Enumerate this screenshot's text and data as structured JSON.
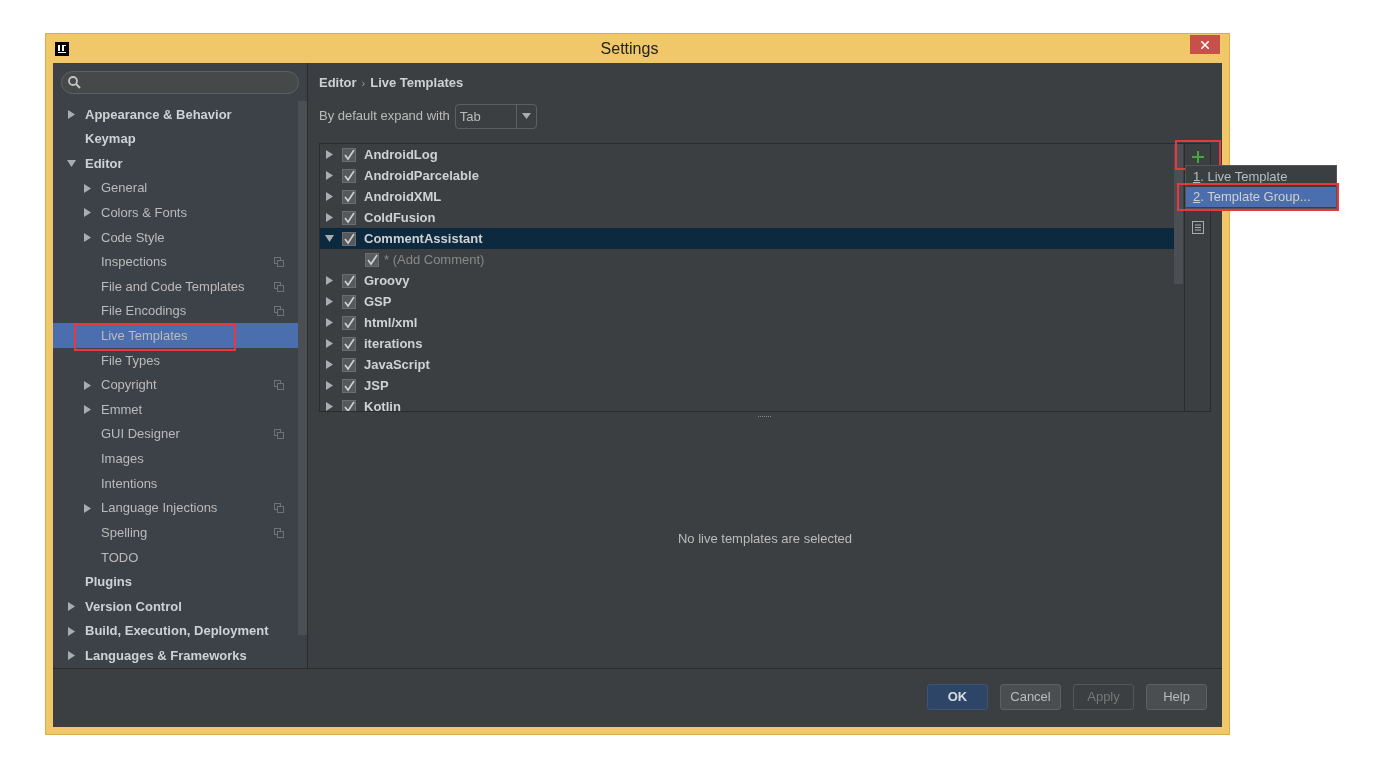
{
  "window": {
    "title": "Settings"
  },
  "sidebar": {
    "items": [
      {
        "label": "Appearance & Behavior",
        "expandable": true,
        "expanded": false,
        "selected": false,
        "highlighted": false,
        "project_level": false
      },
      {
        "label": "Keymap",
        "expandable": false,
        "expanded": false,
        "selected": false,
        "highlighted": false,
        "project_level": false
      },
      {
        "label": "Editor",
        "expandable": true,
        "expanded": true,
        "selected": false,
        "highlighted": false,
        "project_level": false,
        "children": [
          {
            "label": "General",
            "expandable": true,
            "expanded": false,
            "selected": false,
            "highlighted": false,
            "project_level": false
          },
          {
            "label": "Colors & Fonts",
            "expandable": true,
            "expanded": false,
            "selected": false,
            "highlighted": false,
            "project_level": false
          },
          {
            "label": "Code Style",
            "expandable": true,
            "expanded": false,
            "selected": false,
            "highlighted": false,
            "project_level": false
          },
          {
            "label": "Inspections",
            "expandable": false,
            "expanded": false,
            "selected": false,
            "highlighted": false,
            "project_level": true
          },
          {
            "label": "File and Code Templates",
            "expandable": false,
            "expanded": false,
            "selected": false,
            "highlighted": false,
            "project_level": true
          },
          {
            "label": "File Encodings",
            "expandable": false,
            "expanded": false,
            "selected": false,
            "highlighted": false,
            "project_level": true
          },
          {
            "label": "Live Templates",
            "expandable": false,
            "expanded": false,
            "selected": true,
            "highlighted": true,
            "project_level": false
          },
          {
            "label": "File Types",
            "expandable": false,
            "expanded": false,
            "selected": false,
            "highlighted": false,
            "project_level": false
          },
          {
            "label": "Copyright",
            "expandable": true,
            "expanded": false,
            "selected": false,
            "highlighted": false,
            "project_level": true
          },
          {
            "label": "Emmet",
            "expandable": true,
            "expanded": false,
            "selected": false,
            "highlighted": false,
            "project_level": false
          },
          {
            "label": "GUI Designer",
            "expandable": false,
            "expanded": false,
            "selected": false,
            "highlighted": false,
            "project_level": true
          },
          {
            "label": "Images",
            "expandable": false,
            "expanded": false,
            "selected": false,
            "highlighted": false,
            "project_level": false
          },
          {
            "label": "Intentions",
            "expandable": false,
            "expanded": false,
            "selected": false,
            "highlighted": false,
            "project_level": false
          },
          {
            "label": "Language Injections",
            "expandable": true,
            "expanded": false,
            "selected": false,
            "highlighted": false,
            "project_level": true
          },
          {
            "label": "Spelling",
            "expandable": false,
            "expanded": false,
            "selected": false,
            "highlighted": false,
            "project_level": true
          },
          {
            "label": "TODO",
            "expandable": false,
            "expanded": false,
            "selected": false,
            "highlighted": false,
            "project_level": false
          }
        ]
      },
      {
        "label": "Plugins",
        "expandable": false,
        "expanded": false,
        "selected": false,
        "highlighted": false,
        "project_level": false
      },
      {
        "label": "Version Control",
        "expandable": true,
        "expanded": false,
        "selected": false,
        "highlighted": false,
        "project_level": false
      },
      {
        "label": "Build, Execution, Deployment",
        "expandable": true,
        "expanded": false,
        "selected": false,
        "highlighted": false,
        "project_level": false
      },
      {
        "label": "Languages & Frameworks",
        "expandable": true,
        "expanded": false,
        "selected": false,
        "highlighted": false,
        "project_level": false
      }
    ]
  },
  "breadcrumb": [
    "Editor",
    "Live Templates"
  ],
  "breadcrumb_separator": "›",
  "expand_with": {
    "label": "By default expand with",
    "value": "Tab"
  },
  "templates": [
    {
      "label": "AndroidLog",
      "checked": true,
      "expanded": false,
      "selected": false
    },
    {
      "label": "AndroidParcelable",
      "checked": true,
      "expanded": false,
      "selected": false
    },
    {
      "label": "AndroidXML",
      "checked": true,
      "expanded": false,
      "selected": false
    },
    {
      "label": "ColdFusion",
      "checked": true,
      "expanded": false,
      "selected": false
    },
    {
      "label": "CommentAssistant",
      "checked": true,
      "expanded": true,
      "selected": true,
      "children": [
        {
          "label": "* (Add Comment)",
          "checked": true
        }
      ]
    },
    {
      "label": "Groovy",
      "checked": true,
      "expanded": false,
      "selected": false
    },
    {
      "label": "GSP",
      "checked": true,
      "expanded": false,
      "selected": false
    },
    {
      "label": "html/xml",
      "checked": true,
      "expanded": false,
      "selected": false
    },
    {
      "label": "iterations",
      "checked": true,
      "expanded": false,
      "selected": false
    },
    {
      "label": "JavaScript",
      "checked": true,
      "expanded": false,
      "selected": false
    },
    {
      "label": "JSP",
      "checked": true,
      "expanded": false,
      "selected": false
    },
    {
      "label": "Kotlin",
      "checked": true,
      "expanded": false,
      "selected": false
    }
  ],
  "toolbar": {
    "add_highlighted": true
  },
  "add_menu": [
    {
      "mnemonic": "1",
      "label": ". Live Template",
      "selected": false,
      "highlighted": false
    },
    {
      "mnemonic": "2",
      "label": ". Template Group...",
      "selected": true,
      "highlighted": true
    }
  ],
  "empty_message": "No live templates are selected",
  "buttons": [
    {
      "label": "OK",
      "kind": "default"
    },
    {
      "label": "Cancel",
      "kind": "normal"
    },
    {
      "label": "Apply",
      "kind": "disabled"
    },
    {
      "label": "Help",
      "kind": "normal"
    }
  ]
}
